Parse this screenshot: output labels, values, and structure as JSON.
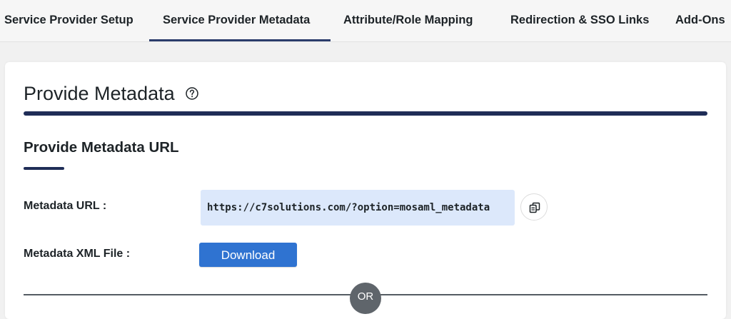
{
  "tabs": [
    {
      "label": "Service Provider Setup",
      "active": false
    },
    {
      "label": "Service Provider Metadata",
      "active": true
    },
    {
      "label": "Attribute/Role Mapping",
      "active": false
    },
    {
      "label": "Redirection & SSO Links",
      "active": false
    },
    {
      "label": "Add-Ons",
      "active": false
    }
  ],
  "page": {
    "title": "Provide Metadata",
    "help_icon": "question-circle-icon"
  },
  "section": {
    "heading": "Provide Metadata URL"
  },
  "metadata_url": {
    "label": "Metadata URL :",
    "value": "https://c7solutions.com/?option=mosaml_metadata",
    "copy_icon": "copy-icon"
  },
  "metadata_file": {
    "label": "Metadata XML File :",
    "button_label": "Download"
  },
  "divider": {
    "label": "OR"
  },
  "colors": {
    "accent_navy": "#1f2d57",
    "button_blue": "#2f73d1",
    "url_box_bg": "#dce8fb",
    "or_badge_gray": "#5f656b"
  }
}
